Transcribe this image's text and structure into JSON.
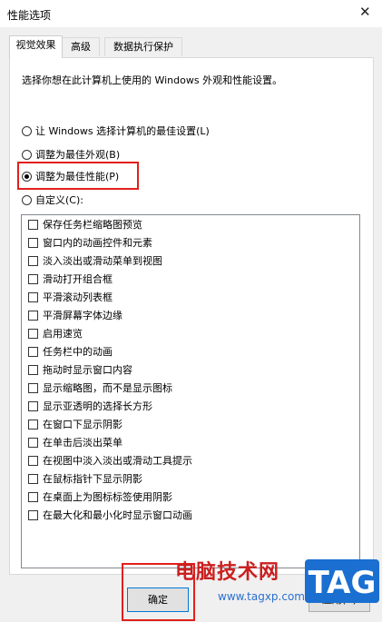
{
  "window": {
    "title": "性能选项",
    "close_glyph": "✕"
  },
  "tabs": [
    {
      "label": "视觉效果",
      "active": true
    },
    {
      "label": "高级",
      "active": false
    },
    {
      "label": "数据执行保护",
      "active": false
    }
  ],
  "description": "选择你想在此计算机上使用的 Windows 外观和性能设置。",
  "radios": [
    {
      "label": "让 Windows 选择计算机的最佳设置(L)",
      "selected": false
    },
    {
      "label": "调整为最佳外观(B)",
      "selected": false
    },
    {
      "label": "调整为最佳性能(P)",
      "selected": true
    },
    {
      "label": "自定义(C):",
      "selected": false
    }
  ],
  "checkboxes": [
    {
      "label": "保存任务栏缩略图预览",
      "checked": false
    },
    {
      "label": "窗口内的动画控件和元素",
      "checked": false
    },
    {
      "label": "淡入淡出或滑动菜单到视图",
      "checked": false
    },
    {
      "label": "滑动打开组合框",
      "checked": false
    },
    {
      "label": "平滑滚动列表框",
      "checked": false
    },
    {
      "label": "平滑屏幕字体边缘",
      "checked": false
    },
    {
      "label": "启用速览",
      "checked": false
    },
    {
      "label": "任务栏中的动画",
      "checked": false
    },
    {
      "label": "拖动时显示窗口内容",
      "checked": false
    },
    {
      "label": "显示缩略图，而不是显示图标",
      "checked": false
    },
    {
      "label": "显示亚透明的选择长方形",
      "checked": false
    },
    {
      "label": "在窗口下显示阴影",
      "checked": false
    },
    {
      "label": "在单击后淡出菜单",
      "checked": false
    },
    {
      "label": "在视图中淡入淡出或滑动工具提示",
      "checked": false
    },
    {
      "label": "在鼠标指针下显示阴影",
      "checked": false
    },
    {
      "label": "在桌面上为图标标签使用阴影",
      "checked": false
    },
    {
      "label": "在最大化和最小化时显示窗口动画",
      "checked": false
    }
  ],
  "buttons": {
    "ok": "确定",
    "apply": "应用(A)"
  },
  "watermark": {
    "text": "电脑技术网",
    "url": "www.tagxp.com",
    "logo": "TAG"
  },
  "colors": {
    "highlight": "#e1201d",
    "watermark_red": "#cc1f1f",
    "logo_blue": "#1a6fd1"
  }
}
